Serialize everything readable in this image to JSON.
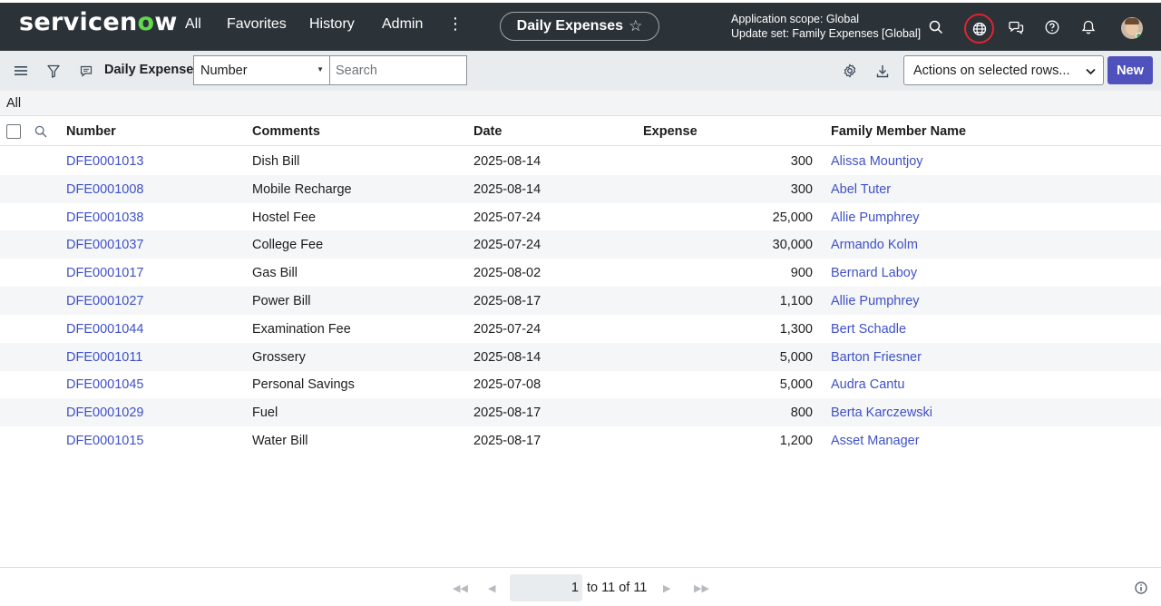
{
  "header": {
    "logo_pre": "servicen",
    "logo_o": "o",
    "logo_post": "w",
    "nav": [
      "All",
      "Favorites",
      "History",
      "Admin"
    ],
    "more": "⋮",
    "page_title": "Daily Expenses",
    "scope_line1": "Application scope: Global",
    "scope_line2": "Update set: Family Expenses [Global]"
  },
  "toolbar": {
    "title": "Daily Expenses",
    "field_select": "Number",
    "search_placeholder": "Search",
    "actions_label": "Actions on selected rows...",
    "new_label": "New"
  },
  "breadcrumb": "All",
  "table": {
    "columns": [
      "Number",
      "Comments",
      "Date",
      "Expense",
      "Family Member Name"
    ],
    "rows": [
      {
        "number": "DFE0001013",
        "comments": "Dish Bill",
        "date": "2025-08-14",
        "expense": "300",
        "member": "Alissa Mountjoy"
      },
      {
        "number": "DFE0001008",
        "comments": "Mobile Recharge",
        "date": "2025-08-14",
        "expense": "300",
        "member": "Abel Tuter"
      },
      {
        "number": "DFE0001038",
        "comments": "Hostel Fee",
        "date": "2025-07-24",
        "expense": "25,000",
        "member": "Allie Pumphrey"
      },
      {
        "number": "DFE0001037",
        "comments": "College Fee",
        "date": "2025-07-24",
        "expense": "30,000",
        "member": "Armando Kolm"
      },
      {
        "number": "DFE0001017",
        "comments": "Gas Bill",
        "date": "2025-08-02",
        "expense": "900",
        "member": "Bernard Laboy"
      },
      {
        "number": "DFE0001027",
        "comments": "Power Bill",
        "date": "2025-08-17",
        "expense": "1,100",
        "member": "Allie Pumphrey"
      },
      {
        "number": "DFE0001044",
        "comments": "Examination Fee",
        "date": "2025-07-24",
        "expense": "1,300",
        "member": "Bert Schadle"
      },
      {
        "number": "DFE0001011",
        "comments": "Grossery",
        "date": "2025-08-14",
        "expense": "5,000",
        "member": "Barton Friesner"
      },
      {
        "number": "DFE0001045",
        "comments": "Personal Savings",
        "date": "2025-07-08",
        "expense": "5,000",
        "member": "Audra Cantu"
      },
      {
        "number": "DFE0001029",
        "comments": "Fuel",
        "date": "2025-08-17",
        "expense": "800",
        "member": "Berta Karczewski"
      },
      {
        "number": "DFE0001015",
        "comments": "Water Bill",
        "date": "2025-08-17",
        "expense": "1,200",
        "member": "Asset Manager"
      }
    ]
  },
  "pagination": {
    "current": "1",
    "range_text": "to 11 of 11"
  },
  "colors": {
    "nav_bg": "#2b3238",
    "accent": "#4f52bd",
    "link": "#3f51c7",
    "logo_green": "#62d84e",
    "scope_ring": "#e0252e"
  }
}
